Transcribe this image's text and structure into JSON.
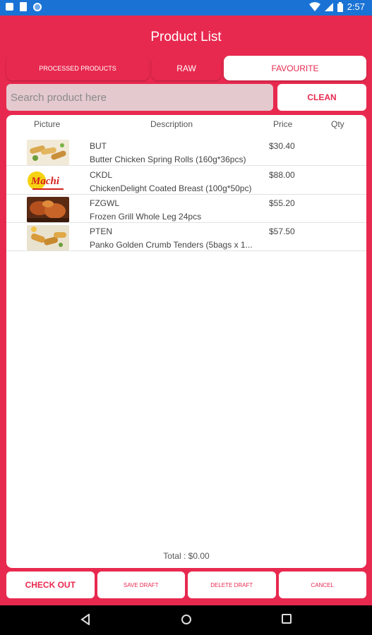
{
  "status_bar": {
    "time": "2:57"
  },
  "app": {
    "title": "Product List"
  },
  "tabs": [
    {
      "label": "PROCESSED PRODUCTS",
      "active": false
    },
    {
      "label": "RAW",
      "active": false
    },
    {
      "label": "FAVOURITE",
      "active": true
    }
  ],
  "search": {
    "placeholder": "Search product here",
    "value": "",
    "clean_label": "CLEAN"
  },
  "table": {
    "headers": [
      "Picture",
      "Description",
      "Price",
      "Qty"
    ],
    "rows": [
      {
        "code": "BUT",
        "description": "Butter Chicken Spring Rolls (160g*36pcs)",
        "price": "$30.40",
        "qty": "",
        "image": "spring-rolls-image"
      },
      {
        "code": "CKDL",
        "description": "ChickenDelight Coated Breast (100g*50pc)",
        "price": "$88.00",
        "qty": "",
        "image": "machi-logo-image"
      },
      {
        "code": "FZGWL",
        "description": "Frozen Grill Whole Leg 24pcs",
        "price": "$55.20",
        "qty": "",
        "image": "grilled-leg-image"
      },
      {
        "code": "PTEN",
        "description": "Panko Golden Crumb Tenders (5bags x 1...",
        "price": "$57.50",
        "qty": "",
        "image": "tenders-image"
      }
    ]
  },
  "total": "Total : $0.00",
  "buttons": {
    "checkout": "CHECK OUT",
    "save_draft": "SAVE DRAFT",
    "delete_draft": "DELETE DRAFT",
    "cancel": "CANCEL"
  },
  "images": {
    "machi_logo_text": "Machi"
  },
  "colors": {
    "primary": "#e8294f",
    "status_bar": "#1a73d4",
    "search_bg": "#e4c9cf"
  }
}
